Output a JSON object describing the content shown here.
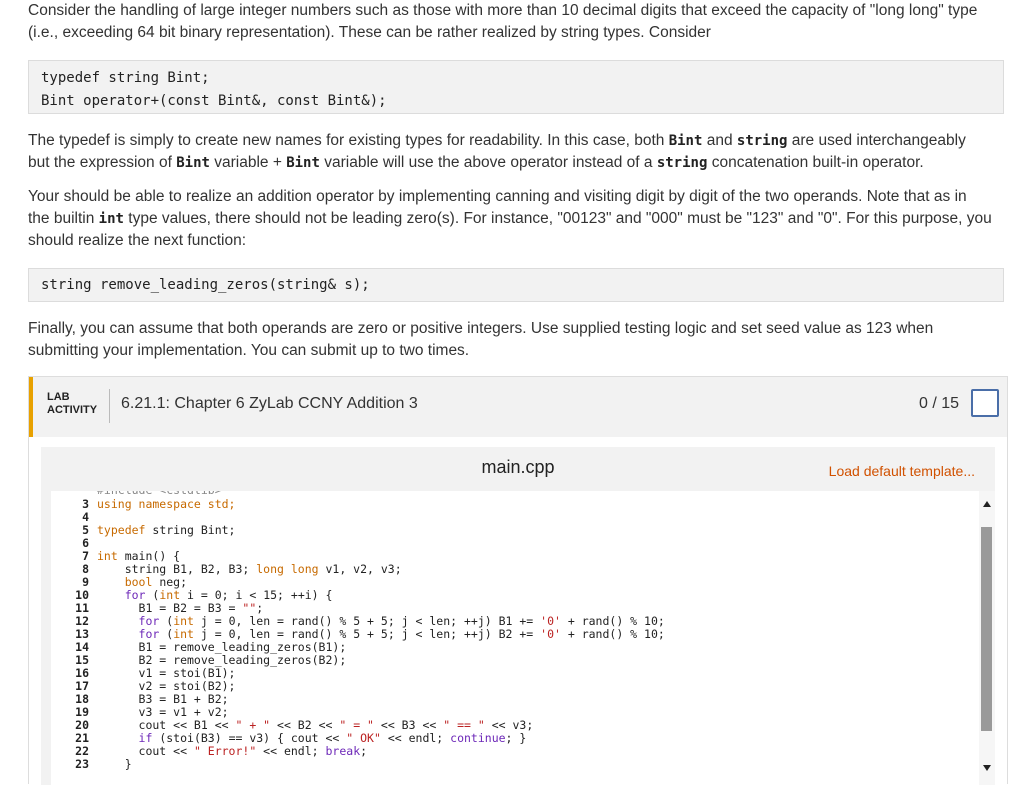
{
  "intro": {
    "line1": "Consider the handling of large integer numbers such as those with more than 10 decimal digits that exceed the capacity of \"long long\" type",
    "line2": "(i.e., exceeding 64 bit binary representation). These can be rather realized by string types. Consider"
  },
  "typedef_box": {
    "line1": "typedef string Bint;",
    "line2": "Bint operator+(const Bint&, const Bint&);"
  },
  "para2": {
    "t1": "The typedef is simply to create new names for existing types for readability. In this case, both ",
    "c1": "Bint",
    "t2": " and ",
    "c2": "string",
    "t3": " are used interchangeably",
    "t4": "but the expression of ",
    "c3": "Bint",
    "t5": " variable + ",
    "c4": "Bint",
    "t6": " variable will use the above operator instead of a ",
    "c5": "string",
    "t7": " concatenation built-in operator."
  },
  "para3": {
    "t1": "Your should be able to realize an addition operator by implementing canning and visiting digit by digit of the two operands. Note that as in",
    "t2": "the builtin ",
    "c1": "int",
    "t3": " type values, there should not be leading zero(s). For instance, \"00123\" and \"000\" must be \"123\" and \"0\". For this purpose, you",
    "t4": "should realize the next function:"
  },
  "func_box": {
    "line1": "string remove_leading_zeros(string& s);"
  },
  "para4": {
    "line1": "Finally, you can assume that both operands are zero or positive integers. Use supplied testing logic and set seed value as 123 when",
    "line2": "submitting your implementation. You can submit up to two times."
  },
  "lab": {
    "tag_line1": "LAB",
    "tag_line2": "ACTIVITY",
    "title": "6.21.1: Chapter 6 ZyLab CCNY Addition 3",
    "score": "0 / 15",
    "accent_color": "#e8a100"
  },
  "editor": {
    "file_name": "main.cpp",
    "load_template": "Load default template...",
    "line_numbers": [
      "3",
      "4",
      "5",
      "6",
      "7",
      "8",
      "9",
      "10",
      "11",
      "12",
      "13",
      "14",
      "15",
      "16",
      "17",
      "18",
      "19",
      "20",
      "21",
      "22",
      "23"
    ],
    "lines": {
      "l3": "using namespace std;",
      "l5a": "typedef",
      "l5b": " string Bint;",
      "l7a": "int",
      "l7b": " main() {",
      "l8a": "    string B1, B2, B3; ",
      "l8b": "long long",
      "l8c": " v1, v2, v3;",
      "l9a": "    ",
      "l9b": "bool",
      "l9c": " neg;",
      "l10a": "    ",
      "l10b": "for",
      "l10c": " (",
      "l10d": "int",
      "l10e": " i = 0; i < 15; ++i) {",
      "l11a": "      B1 = B2 = B3 = ",
      "l11b": "\"\"",
      "l11c": ";",
      "l12a": "      ",
      "l12b": "for",
      "l12c": " (",
      "l12d": "int",
      "l12e": " j = 0, len = rand() % 5 + 5; j < len; ++j) B1 += ",
      "l12f": "'0'",
      "l12g": " + rand() % 10;",
      "l13a": "      ",
      "l13b": "for",
      "l13c": " (",
      "l13d": "int",
      "l13e": " j = 0, len = rand() % 5 + 5; j < len; ++j) B2 += ",
      "l13f": "'0'",
      "l13g": " + rand() % 10;",
      "l14": "      B1 = remove_leading_zeros(B1);",
      "l15": "      B2 = remove_leading_zeros(B2);",
      "l16": "      v1 = stoi(B1);",
      "l17": "      v2 = stoi(B2);",
      "l18": "      B3 = B1 + B2;",
      "l19": "      v3 = v1 + v2;",
      "l20a": "      cout << B1 << ",
      "l20b": "\" + \"",
      "l20c": " << B2 << ",
      "l20d": "\" = \"",
      "l20e": " << B3 << ",
      "l20f": "\" == \"",
      "l20g": " << v3;",
      "l21a": "      ",
      "l21b": "if",
      "l21c": " (stoi(B3) == v3) { cout << ",
      "l21d": "\" OK\"",
      "l21e": " << endl; ",
      "l21f": "continue",
      "l21g": "; }",
      "l22a": "      cout << ",
      "l22b": "\" Error!\"",
      "l22c": " << endl; ",
      "l22d": "break",
      "l22e": ";",
      "l23": "    }"
    }
  }
}
